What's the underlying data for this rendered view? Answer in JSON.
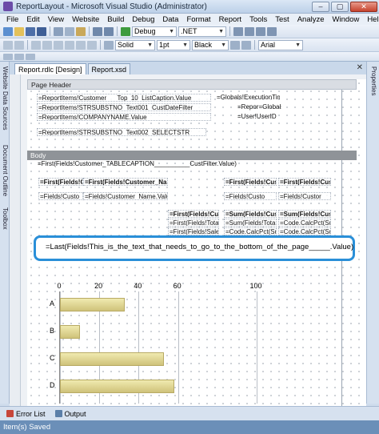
{
  "window": {
    "title": "ReportLayout - Microsoft Visual Studio (Administrator)",
    "buttons": [
      "–",
      "▢",
      "✕"
    ]
  },
  "menu": [
    "File",
    "Edit",
    "View",
    "Website",
    "Build",
    "Debug",
    "Data",
    "Format",
    "Report",
    "Tools",
    "Test",
    "Analyze",
    "Window",
    "Help"
  ],
  "toolbar1": {
    "config": "Debug",
    "platform": ".NET"
  },
  "toolbar2": {
    "line_style": "Solid",
    "line_width": "1pt",
    "line_color": "Black",
    "font": "Arial"
  },
  "left_panels": [
    "Website Data Sources",
    "Document Outline",
    "Toolbox"
  ],
  "right_panels": [
    "Properties"
  ],
  "doc_tabs": [
    {
      "label": "Report.rdlc [Design]",
      "active": true
    },
    {
      "label": "Report.xsd",
      "active": false
    }
  ],
  "designer": {
    "page_header_label": "Page Header",
    "body_label": "Body",
    "header_fields": [
      "=ReportItems!Customer___Top_10_ListCaption.Value",
      "=Globals!ExecutionTime",
      "=ReportItems!STRSUBSTNO_Text001_CustDateFilter",
      "=Repor=Globals",
      "=ReportItems!COMPANYNAME.Value",
      "=User!UserID",
      "=ReportItems!STRSUBSTNO_Text002_SELECTSTR"
    ],
    "body_caption": "=First(Fields!Customer_TABLECAPTION__________CustFilter.Value)",
    "table_headers": [
      "=First(Fields!C",
      "=First(Fields!Customer_Nam",
      "=First(Fields!Custo",
      "=First(Fields!Custo"
    ],
    "table_details": [
      "=Fields!Custo",
      "=Fields!Customer_Name.Value",
      "=Fields!Custo",
      "=Fields!Custor"
    ],
    "table_totals_row1": [
      "=First(Fields!Custo",
      "=Sum(Fields!Custo",
      "=Sum(Fields!Custo"
    ],
    "table_totals_row2": [
      "=First(Fields!Total",
      "=Sum(Fields!Total",
      "=Code.CalcPct(Su"
    ],
    "table_totals_row3": [
      "=First(Fields!Sales",
      "=Code.CalcPct(Su",
      "=Code.CalcPct(Su"
    ],
    "highlighted_expression": "=Last(Fields!This_is_the_text_that_needs_to_go_to_the_bottom_of_the_page_____.Value)"
  },
  "chart_data": {
    "type": "bar",
    "orientation": "horizontal",
    "categories": [
      "A",
      "B",
      "C",
      "D"
    ],
    "values": [
      33,
      10,
      53,
      58
    ],
    "xticks": [
      "0",
      "20",
      "40",
      "60",
      "100"
    ],
    "xlim": [
      0,
      100
    ],
    "bar_color": "#d9cf8c"
  },
  "bottom_tabs": [
    "Error List",
    "Output"
  ],
  "status": "Item(s) Saved"
}
